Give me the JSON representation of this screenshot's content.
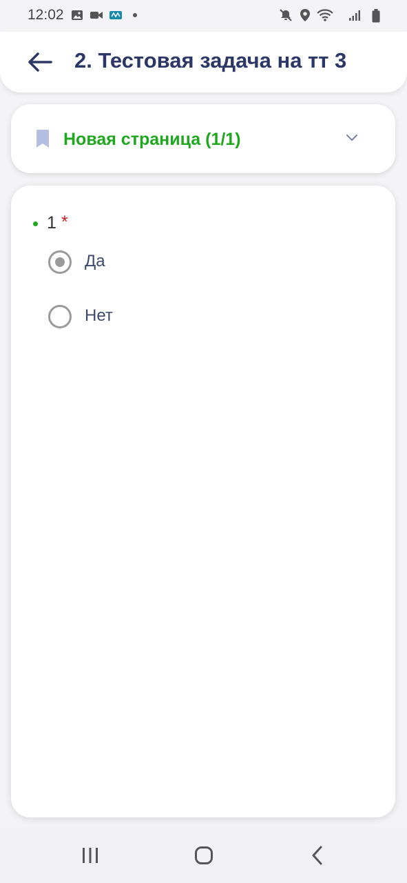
{
  "status_bar": {
    "time": "12:02",
    "left_icons": [
      "image-icon",
      "video-icon",
      "app-notification-icon",
      "dot-icon"
    ],
    "right_icons": [
      "mute-icon",
      "location-icon",
      "wifi-icon",
      "signal-icon",
      "battery-icon"
    ]
  },
  "header": {
    "title": "2. Тестовая задача на тт 3",
    "back_icon": "arrow-left-icon"
  },
  "section": {
    "label": "Новая страница (1/1)",
    "icon": "bookmark-icon",
    "expand_icon": "chevron-down-icon"
  },
  "question": {
    "number": "1",
    "required_mark": "*",
    "options": [
      {
        "label": "Да",
        "selected": true
      },
      {
        "label": "Нет",
        "selected": false
      }
    ]
  },
  "nav_bar": {
    "buttons": [
      "recents-icon",
      "home-icon",
      "back-icon"
    ]
  },
  "colors": {
    "title": "#2c3766",
    "accent_green": "#1fa81f",
    "required_red": "#d32222",
    "bookmark": "#b5bde0",
    "radio_gray": "#9a9a9a"
  }
}
